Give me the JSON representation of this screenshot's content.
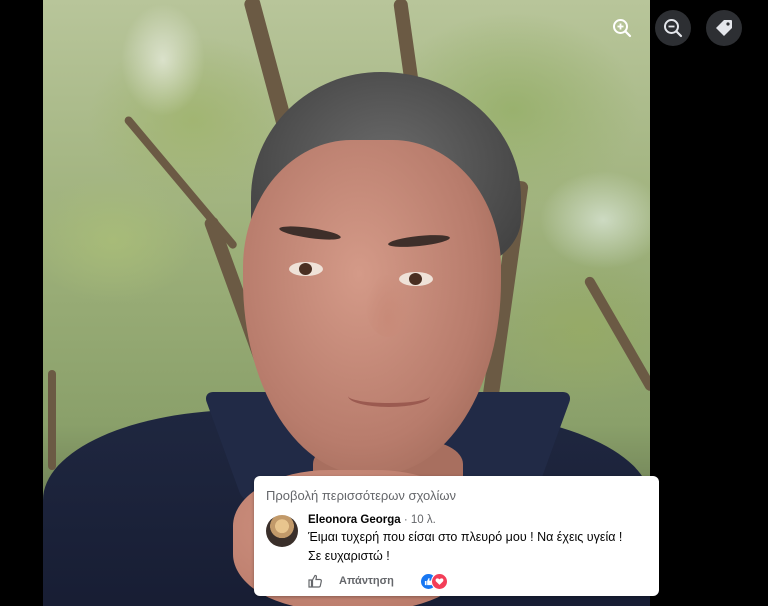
{
  "viewer": {
    "controls": [
      {
        "name": "zoom-in",
        "icon": "zoom-in-icon"
      },
      {
        "name": "zoom-out",
        "icon": "zoom-out-icon"
      },
      {
        "name": "tag",
        "icon": "tag-icon"
      }
    ]
  },
  "comments": {
    "view_more": "Προβολή περισσότερων σχολίων",
    "items": [
      {
        "author": "Eleonora Georga",
        "separator": " · ",
        "time": "10 λ.",
        "text_line1": "Έιμαι τυχερή που είσαι στο πλευρό μου ! Να έχεις υγεία !",
        "text_line2": "Σε ευχαριστώ !",
        "like_icon": "thumbs-up-icon",
        "reply_label": "Απάντηση",
        "reactions": [
          "like-reaction-icon",
          "love-reaction-icon"
        ]
      }
    ]
  },
  "colors": {
    "background": "#000000",
    "accent_blue": "#1877f2",
    "love_red": "#f33e58",
    "secondary_text": "#65676b"
  }
}
